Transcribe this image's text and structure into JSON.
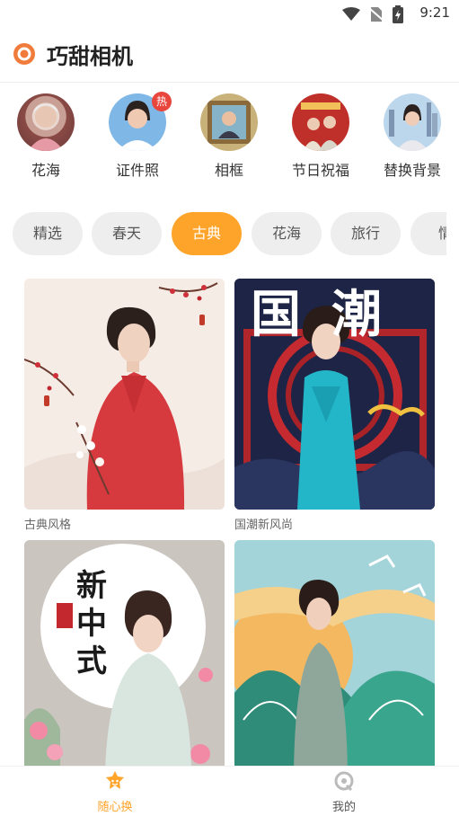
{
  "status": {
    "time": "9:21"
  },
  "app": {
    "title": "巧甜相机"
  },
  "shortcuts": [
    {
      "label": "花海"
    },
    {
      "label": "证件照",
      "badge": "热"
    },
    {
      "label": "相框"
    },
    {
      "label": "节日祝福"
    },
    {
      "label": "替换背景"
    }
  ],
  "categories": [
    "精选",
    "春天",
    "古典",
    "花海",
    "旅行",
    "情"
  ],
  "active_category": "古典",
  "cards": [
    {
      "caption": "古典风格"
    },
    {
      "caption": "国潮新风尚",
      "overlay_text": "国潮"
    },
    {
      "caption": "",
      "overlay_text": "新中式"
    },
    {
      "caption": ""
    }
  ],
  "tabbar": {
    "tab1_label": "随心换",
    "tab2_label": "我的"
  },
  "colors": {
    "accent": "#ffa42a",
    "badge": "#e8453c"
  }
}
